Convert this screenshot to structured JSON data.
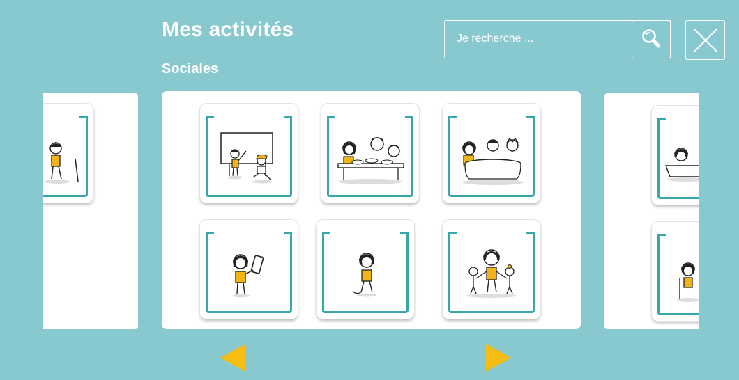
{
  "page": {
    "title": "Mes activités",
    "category": "Sociales"
  },
  "search": {
    "placeholder": "Je recherche ...",
    "icon": "search-icon"
  },
  "close": {
    "icon": "close-icon"
  },
  "colors": {
    "background": "#88c9cf",
    "card_frame": "#37a7ac",
    "figure_accent": "#f2b416",
    "arrow": "#f7bd13"
  },
  "activities": [
    {
      "scene": "teacher-with-student-at-whiteboard"
    },
    {
      "scene": "family-eating-at-table"
    },
    {
      "scene": "group-around-round-table"
    },
    {
      "scene": "person-with-phone"
    },
    {
      "scene": "person-walking"
    },
    {
      "scene": "parent-with-children"
    }
  ],
  "prev_page_activities": [
    {
      "scene": "person-sitting-on-chair"
    }
  ],
  "next_page_activities": [
    {
      "scene": "person-in-bathtub"
    },
    {
      "scene": "person-sitting-on-chair"
    }
  ],
  "navigation": {
    "prev_icon": "arrow-left-icon",
    "next_icon": "arrow-right-icon"
  }
}
